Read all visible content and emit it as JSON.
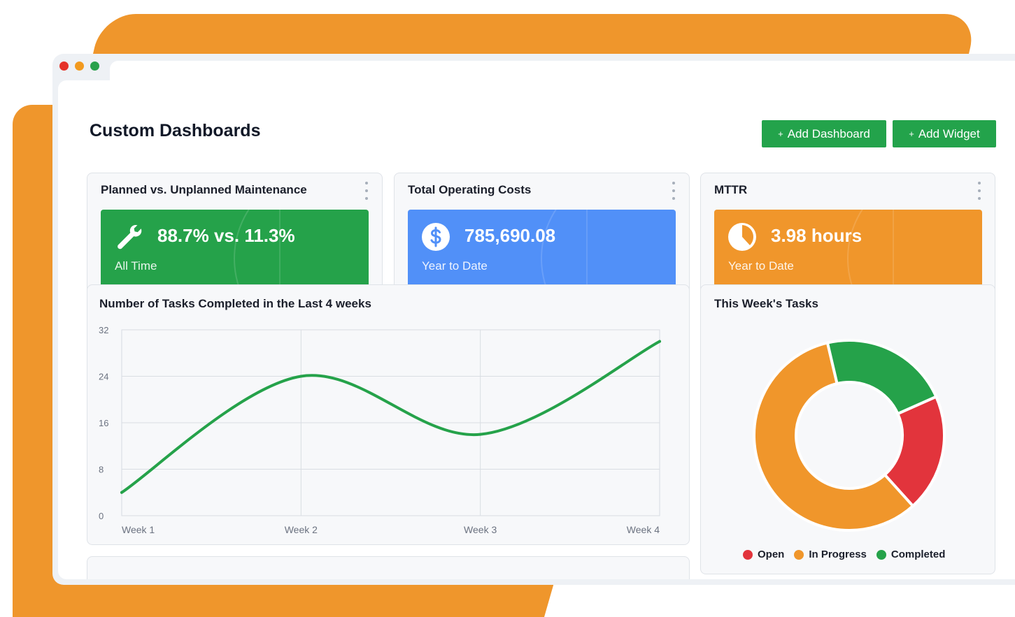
{
  "page": {
    "title": "Custom Dashboards",
    "add_dashboard_label": "Add Dashboard",
    "add_widget_label": "Add Widget",
    "plus_symbol": "+"
  },
  "colors": {
    "backdrop": "#ef962c",
    "green": "#23a34b",
    "blue": "#4f8ff7",
    "orange": "#f0962b",
    "red": "#e2343c"
  },
  "kpis": [
    {
      "title": "Planned vs. Unplanned Maintenance",
      "value": "88.7% vs. 11.3%",
      "subtitle": "All Time",
      "icon": "wrench-icon",
      "color": "#25a24a"
    },
    {
      "title": "Total Operating Costs",
      "value": "785,690.08",
      "subtitle": "Year to Date",
      "icon": "dollar-icon",
      "color": "#5190f8"
    },
    {
      "title": "MTTR",
      "value": "3.98 hours",
      "subtitle": "Year to Date",
      "icon": "clock-icon",
      "color": "#f0962b"
    }
  ],
  "line_chart": {
    "title": "Number of Tasks Completed in the Last 4 weeks"
  },
  "donut_chart": {
    "title": "This Week's Tasks"
  },
  "chart_data": [
    {
      "type": "line",
      "title": "Number of Tasks Completed in the Last 4 weeks",
      "categories": [
        "Week 1",
        "Week 2",
        "Week 3",
        "Week 4"
      ],
      "x": [
        1,
        2,
        3,
        4
      ],
      "series": [
        {
          "values": [
            4,
            24,
            14,
            30
          ],
          "color": "#25a24a"
        }
      ],
      "yticks": [
        "0",
        "8",
        "16",
        "24",
        "32"
      ],
      "ylim": [
        0,
        32
      ],
      "grid": true
    },
    {
      "type": "pie",
      "title": "This Week's Tasks",
      "labels": [
        "Open",
        "In Progress",
        "Completed"
      ],
      "values": [
        20,
        58,
        22
      ],
      "colors": [
        "#e2343c",
        "#f0962b",
        "#25a24a"
      ],
      "legend": "bottom"
    }
  ]
}
